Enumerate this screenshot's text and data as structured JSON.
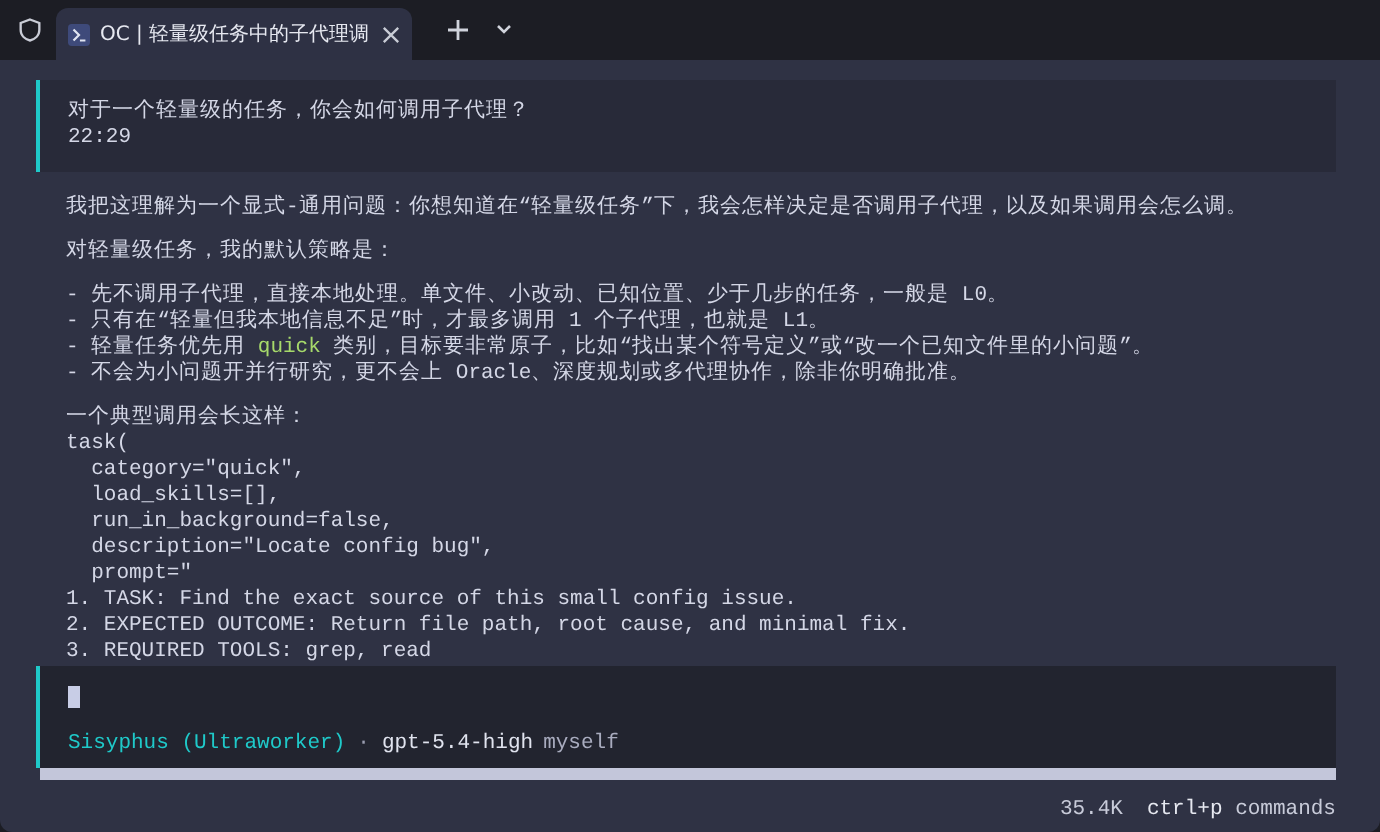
{
  "tab": {
    "title": "OC | 轻量级任务中的子代理调",
    "selected": true
  },
  "message": {
    "text": "对于一个轻量级的任务，你会如何调用子代理？",
    "time": "22:29"
  },
  "reply": [
    {
      "kind": "text",
      "parts": [
        {
          "text": "我把这理解为一个显式-通用问题：你想知道在“轻量级任务”下，我会怎样决定是否调用子代理，以及如果调用会怎么调。"
        }
      ]
    },
    {
      "kind": "blank"
    },
    {
      "kind": "text",
      "parts": [
        {
          "text": "对轻量级任务，我的默认策略是："
        }
      ]
    },
    {
      "kind": "blank"
    },
    {
      "kind": "text",
      "parts": [
        {
          "text": "- 先不调用子代理，直接本地处理。单文件、小改动、已知位置、少于几步的任务，一般是 L0。"
        }
      ]
    },
    {
      "kind": "text",
      "parts": [
        {
          "text": "- 只有在“轻量但我本地信息不足”时，才最多调用 1 个子代理，也就是 L1。"
        }
      ]
    },
    {
      "kind": "text",
      "parts": [
        {
          "text": "- 轻量任务优先用 "
        },
        {
          "text": "quick",
          "code": true
        },
        {
          "text": " 类别，目标要非常原子，比如“找出某个符号定义”或“改一个已知文件里的小问题”。"
        }
      ]
    },
    {
      "kind": "text",
      "parts": [
        {
          "text": "- 不会为小问题开并行研究，更不会上 Oracle、深度规划或多代理协作，除非你明确批准。"
        }
      ]
    },
    {
      "kind": "blank"
    },
    {
      "kind": "text",
      "parts": [
        {
          "text": "一个典型调用会长这样："
        }
      ]
    },
    {
      "kind": "text",
      "parts": [
        {
          "text": "task("
        }
      ]
    },
    {
      "kind": "text",
      "parts": [
        {
          "text": "  category=\"quick\","
        }
      ]
    },
    {
      "kind": "text",
      "parts": [
        {
          "text": "  load_skills=[],"
        }
      ]
    },
    {
      "kind": "text",
      "parts": [
        {
          "text": "  run_in_background=false,"
        }
      ]
    },
    {
      "kind": "text",
      "parts": [
        {
          "text": "  description=\"Locate config bug\","
        }
      ]
    },
    {
      "kind": "text",
      "parts": [
        {
          "text": "  prompt=\""
        }
      ]
    },
    {
      "kind": "text",
      "parts": [
        {
          "text": "1. TASK: Find the exact source of this small config issue."
        }
      ]
    },
    {
      "kind": "text",
      "parts": [
        {
          "text": "2. EXPECTED OUTCOME: Return file path, root cause, and minimal fix."
        }
      ]
    },
    {
      "kind": "text",
      "parts": [
        {
          "text": "3. REQUIRED TOOLS: grep, read"
        }
      ]
    }
  ],
  "prompt": {
    "agent": "Sisyphus (Ultraworker)",
    "separator": "·",
    "model": "gpt-5.4-high",
    "variant": "myself"
  },
  "status_bar": {
    "tokens": "35.4K",
    "shortcut": "ctrl+p",
    "shortcut_label": "commands"
  }
}
